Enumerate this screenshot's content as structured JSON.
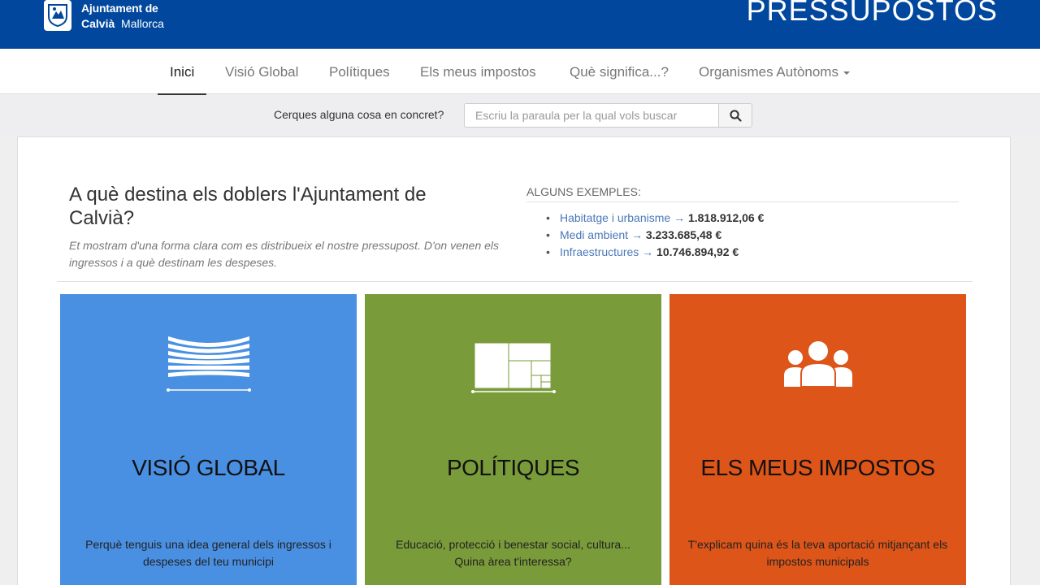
{
  "header": {
    "org_line1": "Ajuntament de",
    "org_line2_bold": "Calvià",
    "org_line2_rest": "Mallorca",
    "app_title": "PRESSUPOSTOS",
    "bg_color": "#00479d"
  },
  "nav": {
    "tabs": [
      {
        "label": "Inici",
        "active": true
      },
      {
        "label": "Visió Global",
        "active": false
      },
      {
        "label": "Polítiques",
        "active": false
      },
      {
        "label": "Els meus impostos",
        "active": false
      },
      {
        "label": "Què significa...?",
        "active": false
      },
      {
        "label": "Organismes Autònoms",
        "active": false,
        "dropdown": true
      }
    ]
  },
  "search": {
    "label": "Cerques alguna cosa en concret?",
    "placeholder": "Escriu la paraula per la qual vols buscar",
    "value": "",
    "button_icon": "search-icon"
  },
  "intro": {
    "headline": "A què destina els doblers l'Ajuntament de Calvià?",
    "subtext": "Et mostram d'una forma clara com es distribueix el nostre pressupost. D'on venen els ingressos i a què destinam les despeses."
  },
  "examples": {
    "title": "ALGUNS EXEMPLES:",
    "items": [
      {
        "label": "Habitatge i urbanisme",
        "arrow": "→",
        "value": "1.818.912,06 €"
      },
      {
        "label": "Medi ambient",
        "arrow": "→",
        "value": "3.233.685,48 €"
      },
      {
        "label": "Infraestructures",
        "arrow": "→",
        "value": "10.746.894,92 €"
      }
    ]
  },
  "cards": [
    {
      "title": "VISIÓ GLOBAL",
      "desc": "Perquè tenguis una idea general dels ingressos i despeses del teu municipi",
      "color": "#4a90e2",
      "icon": "sankey-flow-icon"
    },
    {
      "title": "POLÍTIQUES",
      "desc": "Educació, protecció i benestar social, cultura... Quina àrea t'interessa?",
      "color": "#7a9b3a",
      "icon": "treemap-icon"
    },
    {
      "title": "ELS MEUS IMPOSTOS",
      "desc": "T'explicam quina és la teva aportació mitjançant els impostos municipals",
      "color": "#dd5519",
      "icon": "people-group-icon"
    }
  ]
}
